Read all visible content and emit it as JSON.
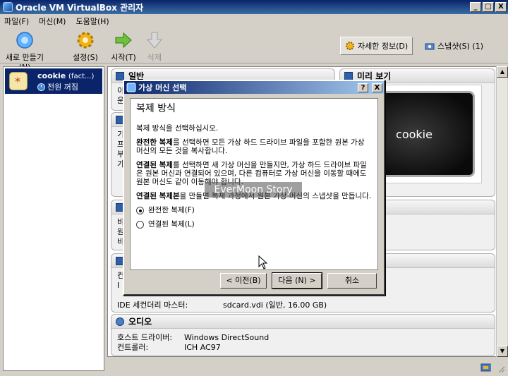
{
  "window": {
    "title": "Oracle VM VirtualBox 관리자",
    "min": "_",
    "max": "□",
    "close": "X"
  },
  "menu": [
    "파일(F)",
    "머신(M)",
    "도움말(H)"
  ],
  "toolbar": {
    "new_label": "새로 만들기(N)",
    "settings_label": "설정(S)",
    "start_label": "시작(T)",
    "delete_label": "삭제",
    "details_tab": "자세한 정보(D)",
    "snapshots_tab": "스냅샷(S) (1)"
  },
  "vm_list": [
    {
      "name": "cookie",
      "suffix": "(fact...)",
      "state": "전원 꺼짐"
    }
  ],
  "details": {
    "general_title": "일반",
    "general_lines": [
      "이",
      "운"
    ],
    "system_lines": [
      "기",
      "프",
      "부",
      "가"
    ],
    "display_lines": [
      "비",
      "원",
      "비"
    ],
    "storage_lines": [
      "컨",
      "I"
    ],
    "storage_last_key": "IDE 세컨더리 마스터:",
    "storage_last_val": "sdcard.vdi (일반, 16.00 GB)",
    "audio_title": "오디오",
    "audio_rows": [
      {
        "k": "호스트 드라이버:",
        "v": "Windows DirectSound"
      },
      {
        "k": "컨트롤러:",
        "v": "ICH AC97"
      }
    ],
    "preview_title": "미리 보기",
    "preview_text": "cookie"
  },
  "dialog": {
    "title": "가상 머신 선택",
    "help": "?",
    "close": "X",
    "heading": "복제 방식",
    "intro": "복제 방식을 선택하십시오.",
    "full_bold": "완전한 복제",
    "full_text": "를 선택하면 모든 가상 하드 드라이브 파일을 포함한 원본 가상 머신의 모든 것을 복사합니다.",
    "linked_bold": "연결된 복제",
    "linked_text": "를 선택하면 새 가상 머신을 만들지만, 가상 하드 드라이브 파일은 원본 머신과 연결되어 있으며, 다른 컴퓨터로 가상 머신을 이동할 때에도 원본 머신도 같이 이동해야 합니다.",
    "snap_bold": "연결된 복제본",
    "snap_text": "을 만들면 복제 과정에서 원본 가상 머신의 스냅샷을 만듭니다.",
    "opt_full": "완전한 복제(F)",
    "opt_linked": "연결된 복제(L)",
    "back": "< 이전(B)",
    "next": "다음 (N) >",
    "cancel": "취소"
  },
  "watermark": "EverMoon Story"
}
